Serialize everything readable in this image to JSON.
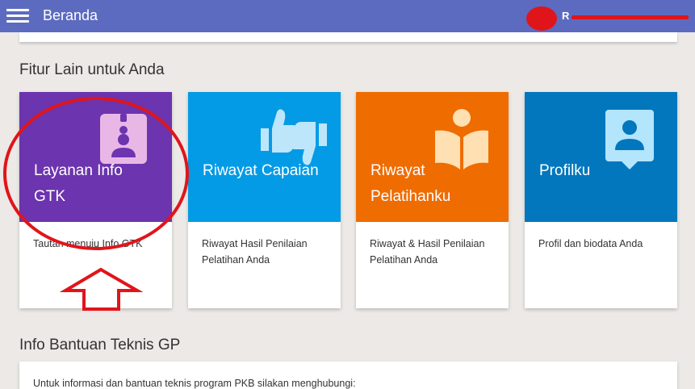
{
  "topbar": {
    "title": "Beranda",
    "user_initial": "R"
  },
  "section1": {
    "heading": "Fitur Lain untuk Anda"
  },
  "cards": [
    {
      "title": "Layanan Info GTK",
      "desc": "Tautan menuju Info GTK",
      "color": "#6c34ae",
      "icon": "id-badge-icon"
    },
    {
      "title": "Riwayat Capaian",
      "desc": "Riwayat Hasil Penilaian Pelatihan Anda",
      "color": "#039be5",
      "icon": "thumbs-icon"
    },
    {
      "title": "Riwayat Pelatihanku",
      "desc": "Riwayat & Hasil Penilaian Pelatihan Anda",
      "color": "#ef6c00",
      "icon": "reader-icon"
    },
    {
      "title": "Profilku",
      "desc": "Profil dan biodata Anda",
      "color": "#0277bd",
      "icon": "profile-icon"
    }
  ],
  "section2": {
    "heading": "Info Bantuan Teknis GP",
    "text": "Untuk informasi dan bantuan teknis program PKB silakan menghubungi:"
  },
  "colors": {
    "topbar": "#5c6bc0",
    "annotation": "#e0151b"
  }
}
